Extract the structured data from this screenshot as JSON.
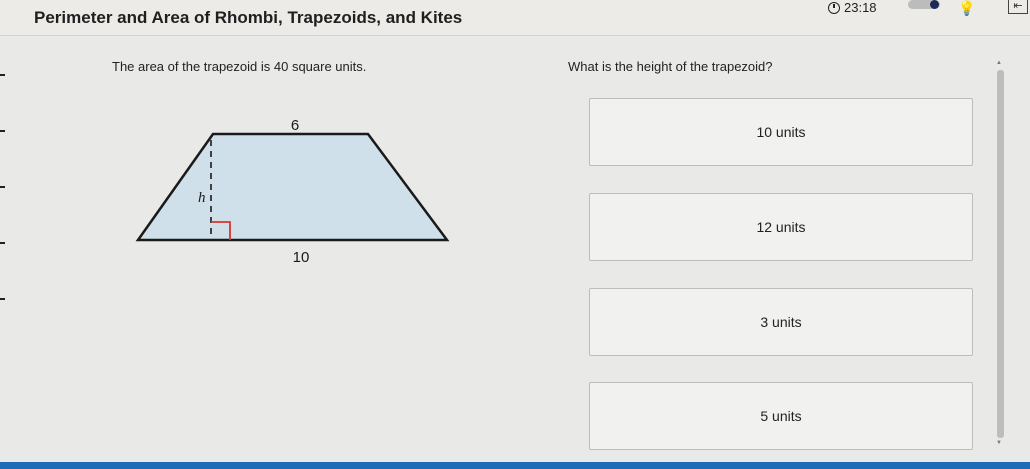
{
  "header": {
    "title": "Perimeter and Area of Rhombi, Trapezoids, and Kites",
    "timer": "23:18",
    "exit_glyph": "⇤"
  },
  "question": {
    "text": "The area of the trapezoid is 40 square units.",
    "prompt": "What is the height of the trapezoid?"
  },
  "figure": {
    "top_base_label": "6",
    "bottom_base_label": "10",
    "height_label": "h",
    "fill_color": "#cfe0ea",
    "right_angle_color": "#d9342b"
  },
  "options": [
    {
      "label": "10 units"
    },
    {
      "label": "12 units"
    },
    {
      "label": "3 units"
    },
    {
      "label": "5 units"
    }
  ],
  "colors": {
    "accent_bar": "#1e6bb8",
    "background": "#e9e9e7"
  },
  "icons": {
    "timer": "clock-icon",
    "hint": "lightbulb-icon",
    "exit": "exit-icon",
    "toggle": "toggle-switch"
  }
}
